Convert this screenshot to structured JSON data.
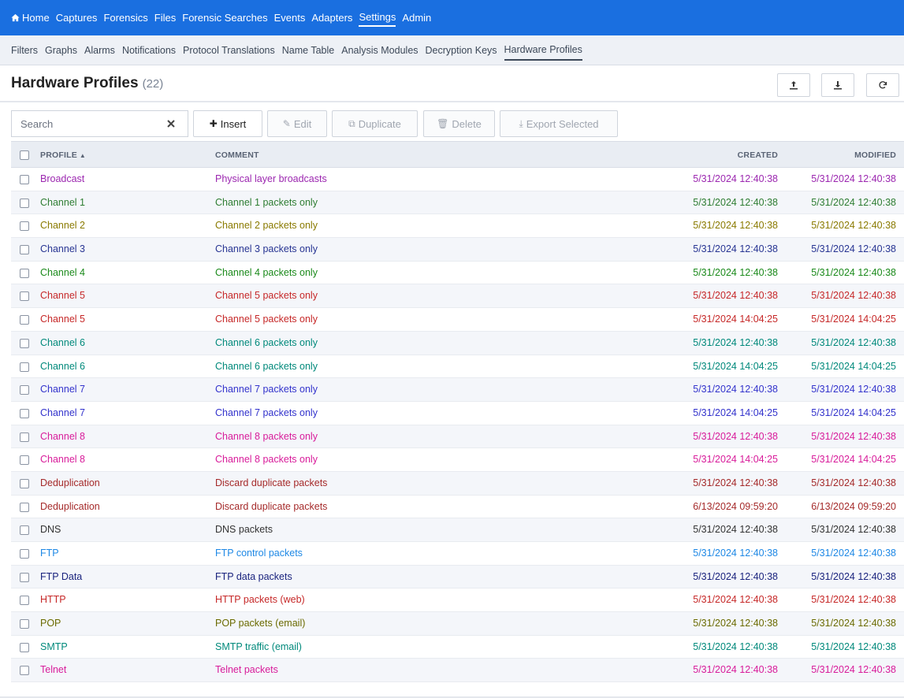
{
  "nav": {
    "items": [
      {
        "label": "Home",
        "active": false
      },
      {
        "label": "Captures",
        "active": false
      },
      {
        "label": "Forensics",
        "active": false
      },
      {
        "label": "Files",
        "active": false
      },
      {
        "label": "Forensic Searches",
        "active": false
      },
      {
        "label": "Events",
        "active": false
      },
      {
        "label": "Adapters",
        "active": false
      },
      {
        "label": "Settings",
        "active": true
      },
      {
        "label": "Admin",
        "active": false
      }
    ]
  },
  "subnav": {
    "items": [
      {
        "label": "Filters",
        "active": false
      },
      {
        "label": "Graphs",
        "active": false
      },
      {
        "label": "Alarms",
        "active": false
      },
      {
        "label": "Notifications",
        "active": false
      },
      {
        "label": "Protocol Translations",
        "active": false
      },
      {
        "label": "Name Table",
        "active": false
      },
      {
        "label": "Analysis Modules",
        "active": false
      },
      {
        "label": "Decryption Keys",
        "active": false
      },
      {
        "label": "Hardware Profiles",
        "active": true
      }
    ]
  },
  "header": {
    "title": "Hardware Profiles",
    "count": "(22)",
    "icons": [
      "upload-icon",
      "download-icon",
      "refresh-icon"
    ]
  },
  "toolbar": {
    "search_placeholder": "Search",
    "insert_label": "Insert",
    "edit_label": "Edit",
    "duplicate_label": "Duplicate",
    "delete_label": "Delete",
    "export_label": "Export Selected"
  },
  "table": {
    "columns": {
      "profile": "PROFILE",
      "comment": "COMMENT",
      "created": "CREATED",
      "modified": "MODIFIED"
    },
    "rows": [
      {
        "profile": "Broadcast",
        "comment": "Physical layer broadcasts",
        "created": "5/31/2024 12:40:38",
        "modified": "5/31/2024 12:40:38",
        "color": "#9c27b0"
      },
      {
        "profile": "Channel 1",
        "comment": "Channel 1 packets only",
        "created": "5/31/2024 12:40:38",
        "modified": "5/31/2024 12:40:38",
        "color": "#2e7d32"
      },
      {
        "profile": "Channel 2",
        "comment": "Channel 2 packets only",
        "created": "5/31/2024 12:40:38",
        "modified": "5/31/2024 12:40:38",
        "color": "#8a7a00"
      },
      {
        "profile": "Channel 3",
        "comment": "Channel 3 packets only",
        "created": "5/31/2024 12:40:38",
        "modified": "5/31/2024 12:40:38",
        "color": "#283593"
      },
      {
        "profile": "Channel 4",
        "comment": "Channel 4 packets only",
        "created": "5/31/2024 12:40:38",
        "modified": "5/31/2024 12:40:38",
        "color": "#1b8a1b"
      },
      {
        "profile": "Channel 5",
        "comment": "Channel 5 packets only",
        "created": "5/31/2024 12:40:38",
        "modified": "5/31/2024 12:40:38",
        "color": "#c62828"
      },
      {
        "profile": "Channel 5",
        "comment": "Channel 5 packets only",
        "created": "5/31/2024 14:04:25",
        "modified": "5/31/2024 14:04:25",
        "color": "#c62828"
      },
      {
        "profile": "Channel 6",
        "comment": "Channel 6 packets only",
        "created": "5/31/2024 12:40:38",
        "modified": "5/31/2024 12:40:38",
        "color": "#00897b"
      },
      {
        "profile": "Channel 6",
        "comment": "Channel 6 packets only",
        "created": "5/31/2024 14:04:25",
        "modified": "5/31/2024 14:04:25",
        "color": "#00897b"
      },
      {
        "profile": "Channel 7",
        "comment": "Channel 7 packets only",
        "created": "5/31/2024 12:40:38",
        "modified": "5/31/2024 12:40:38",
        "color": "#3333cc"
      },
      {
        "profile": "Channel 7",
        "comment": "Channel 7 packets only",
        "created": "5/31/2024 14:04:25",
        "modified": "5/31/2024 14:04:25",
        "color": "#3333cc"
      },
      {
        "profile": "Channel 8",
        "comment": "Channel 8 packets only",
        "created": "5/31/2024 12:40:38",
        "modified": "5/31/2024 12:40:38",
        "color": "#d81b9a"
      },
      {
        "profile": "Channel 8",
        "comment": "Channel 8 packets only",
        "created": "5/31/2024 14:04:25",
        "modified": "5/31/2024 14:04:25",
        "color": "#d81b9a"
      },
      {
        "profile": "Deduplication",
        "comment": "Discard duplicate packets",
        "created": "5/31/2024 12:40:38",
        "modified": "5/31/2024 12:40:38",
        "color": "#a52a2a"
      },
      {
        "profile": "Deduplication",
        "comment": "Discard duplicate packets",
        "created": "6/13/2024 09:59:20",
        "modified": "6/13/2024 09:59:20",
        "color": "#a52a2a"
      },
      {
        "profile": "DNS",
        "comment": "DNS packets",
        "created": "5/31/2024 12:40:38",
        "modified": "5/31/2024 12:40:38",
        "color": "#333333"
      },
      {
        "profile": "FTP",
        "comment": "FTP control packets",
        "created": "5/31/2024 12:40:38",
        "modified": "5/31/2024 12:40:38",
        "color": "#1e88e5"
      },
      {
        "profile": "FTP Data",
        "comment": "FTP data packets",
        "created": "5/31/2024 12:40:38",
        "modified": "5/31/2024 12:40:38",
        "color": "#1a237e"
      },
      {
        "profile": "HTTP",
        "comment": "HTTP packets (web)",
        "created": "5/31/2024 12:40:38",
        "modified": "5/31/2024 12:40:38",
        "color": "#c62828"
      },
      {
        "profile": "POP",
        "comment": "POP packets (email)",
        "created": "5/31/2024 12:40:38",
        "modified": "5/31/2024 12:40:38",
        "color": "#6b6b00"
      },
      {
        "profile": "SMTP",
        "comment": "SMTP traffic (email)",
        "created": "5/31/2024 12:40:38",
        "modified": "5/31/2024 12:40:38",
        "color": "#00897b"
      },
      {
        "profile": "Telnet",
        "comment": "Telnet packets",
        "created": "5/31/2024 12:40:38",
        "modified": "5/31/2024 12:40:38",
        "color": "#d81b9a"
      }
    ]
  }
}
